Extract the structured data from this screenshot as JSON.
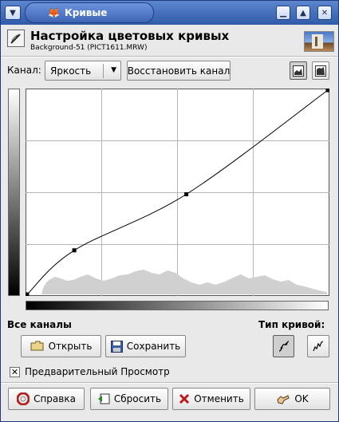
{
  "window": {
    "title": "Кривые"
  },
  "header": {
    "title": "Настройка цветовых кривых",
    "subtitle": "Background-51 (PICT1611.MRW)"
  },
  "channel": {
    "label": "Канал:",
    "value": "Яркость",
    "reset_label": "Восстановить канал"
  },
  "curve": {
    "points": [
      {
        "in": 0,
        "out": 0
      },
      {
        "in": 40,
        "out": 55
      },
      {
        "in": 135,
        "out": 125
      },
      {
        "in": 255,
        "out": 255
      }
    ]
  },
  "sections": {
    "all_channels": "Все каналы",
    "curve_type": "Тип кривой:"
  },
  "buttons": {
    "open": "Открыть",
    "save": "Сохранить",
    "help": "Справка",
    "reset": "Сбросить",
    "cancel": "Отменить",
    "ok": "OK"
  },
  "preview": {
    "label": "Предварительный Просмотр",
    "checked": true
  },
  "icons": {
    "window_menu": "chevron-down-icon",
    "app": "gimp-fox-icon",
    "minimize": "minimize-icon",
    "maximize": "maximize-icon",
    "close": "close-icon",
    "tool": "curves-tool-icon",
    "thumbnail": "image-thumbnail-icon",
    "linear": "linear-histogram-icon",
    "log": "log-histogram-icon",
    "open": "folder-open-icon",
    "save": "floppy-save-icon",
    "help": "lifebuoy-help-icon",
    "reset": "reset-icon",
    "cancel": "cancel-x-icon",
    "ok": "ok-hand-icon",
    "smooth": "smooth-curve-icon",
    "freehand": "freehand-curve-icon"
  }
}
